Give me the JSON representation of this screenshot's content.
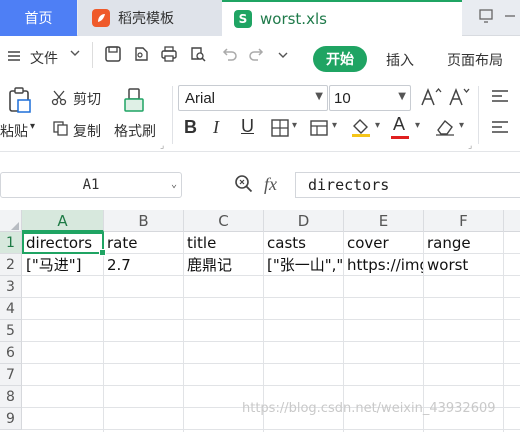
{
  "tabs": {
    "home": "首页",
    "daoke": "稻壳模板",
    "file": "worst.xls",
    "file_icon_letter": "S"
  },
  "menu": {
    "file": "文件",
    "start": "开始",
    "insert": "插入",
    "page_layout": "页面布局"
  },
  "ribbon": {
    "paste": "粘贴",
    "cut": "剪切",
    "copy": "复制",
    "format_painter": "格式刷",
    "font_name": "Arial",
    "font_size": "10",
    "bold": "B",
    "italic": "I",
    "underline": "U",
    "font_color_letter": "A"
  },
  "formula_bar": {
    "cell_ref": "A1",
    "fx": "fx",
    "content": "directors"
  },
  "grid": {
    "columns": [
      "A",
      "B",
      "C",
      "D",
      "E",
      "F"
    ],
    "row_numbers": [
      "1",
      "2",
      "3",
      "4",
      "5",
      "6",
      "7",
      "8",
      "9"
    ],
    "rows": [
      [
        "directors",
        "rate",
        "title",
        "casts",
        "cover",
        "range"
      ],
      [
        "[\"马进\"]",
        "2.7",
        "鹿鼎记",
        "[\"张一山\",\"",
        "https://img",
        "worst"
      ]
    ]
  },
  "watermark": "https://blog.csdn.net/weixin_43932609",
  "colors": {
    "accent_green": "#1fa463",
    "home_tab_blue": "#4e7ff5"
  }
}
